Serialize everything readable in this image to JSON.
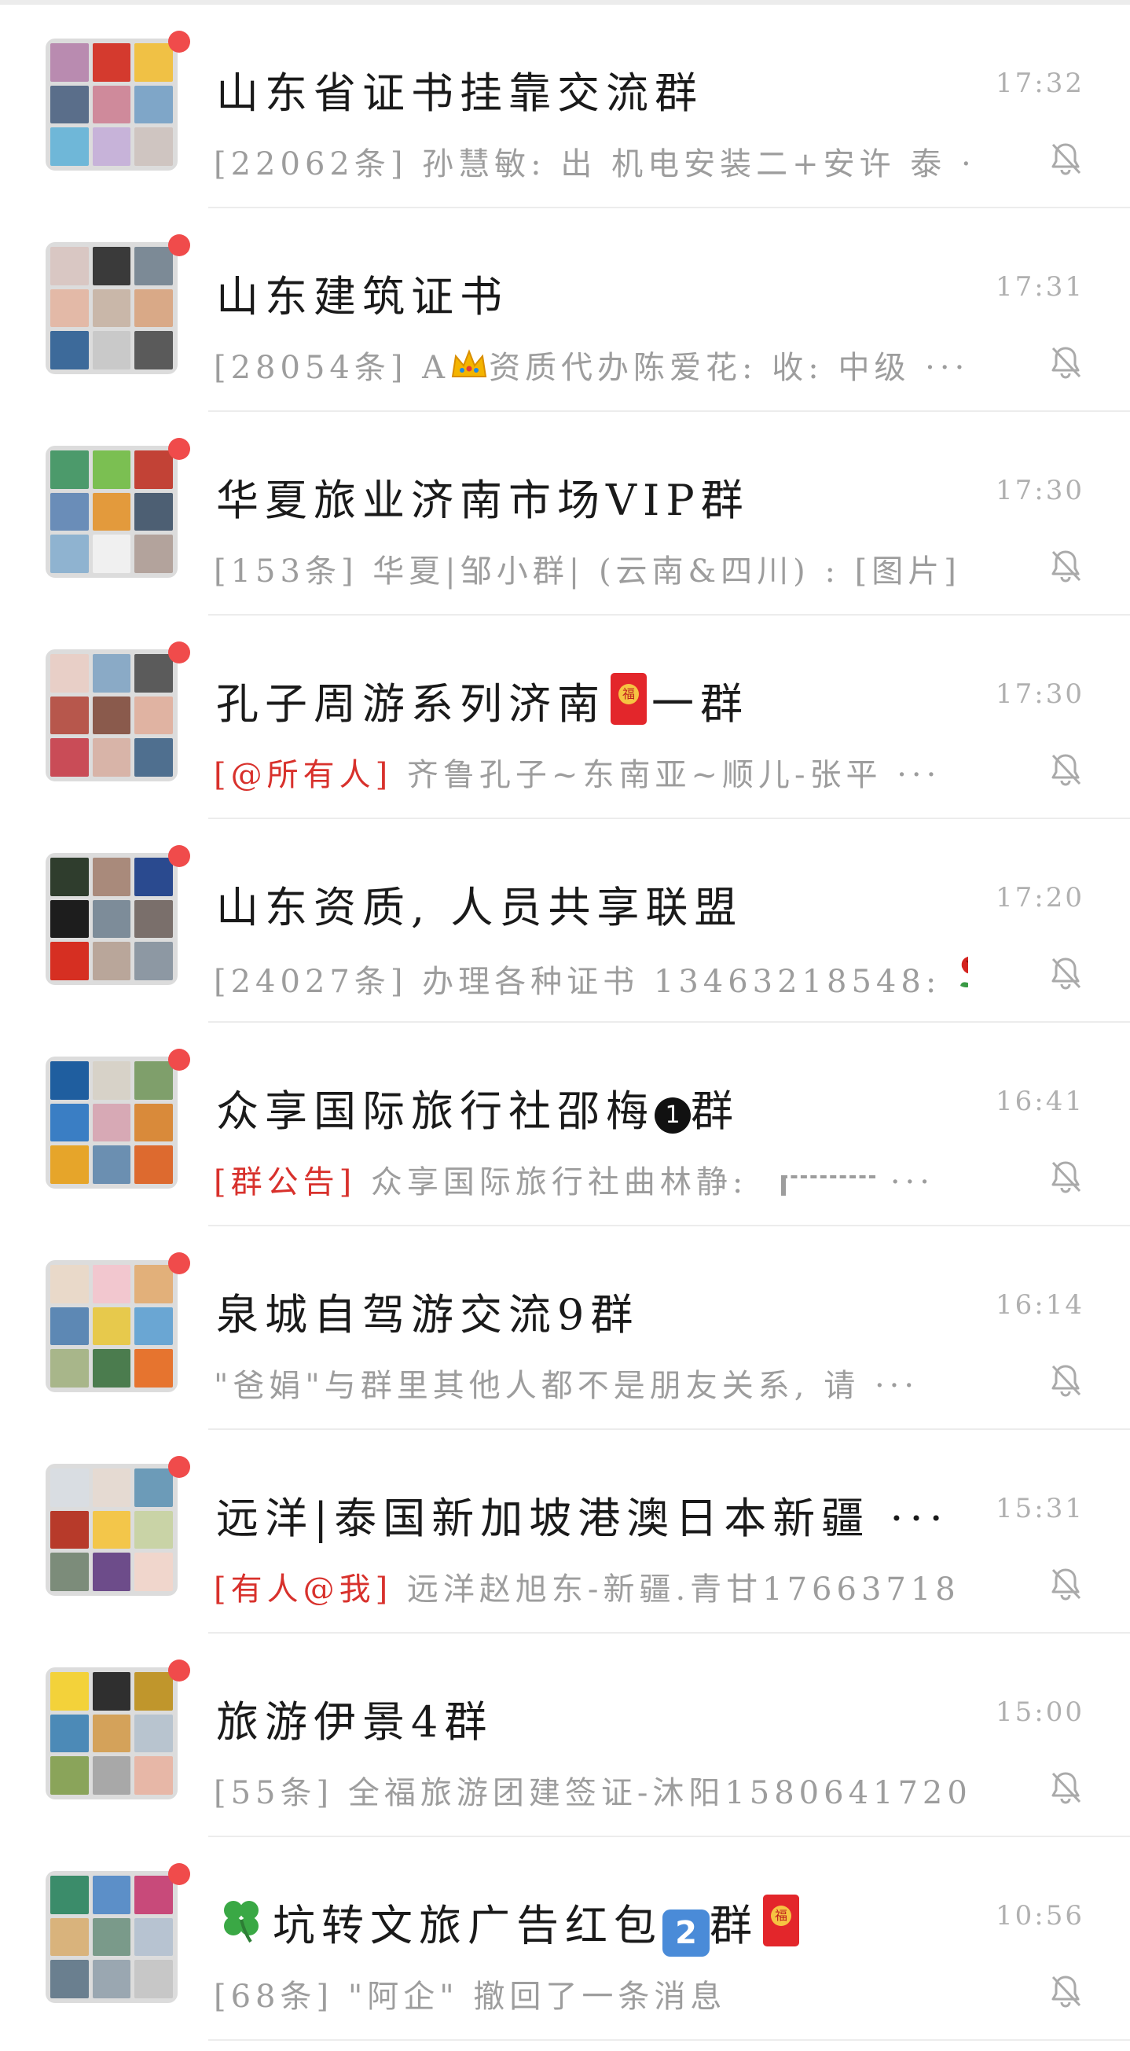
{
  "chats": [
    {
      "title": "山东省证书挂靠交流群",
      "title_extra": "",
      "preview_tag": "",
      "preview": "[22062条] 孙慧敏: 出 机电安装二+安许 泰 ···",
      "time": "17:32",
      "avatar_colors": [
        "#b98bb0",
        "#d43a2e",
        "#f0c145",
        "#5a6e8a",
        "#cf8a9b",
        "#7fa6c8",
        "#6fb7d8",
        "#c7b3d9",
        "#cfc5c1"
      ]
    },
    {
      "title": "山东建筑证书",
      "title_extra": "",
      "preview_tag": "",
      "preview_before": "[28054条] A",
      "preview_after": "资质代办陈爱花: 收: 中级 ···",
      "time": "17:31",
      "avatar_colors": [
        "#d9c7c3",
        "#3a3a3a",
        "#7c8a96",
        "#e3b9a7",
        "#c9b7a9",
        "#d9a987",
        "#3d6a9a",
        "#c9c9c9",
        "#5a5a5a"
      ]
    },
    {
      "title": "华夏旅业济南市场VIP群",
      "title_extra": "",
      "preview_tag": "",
      "preview": "[153条] 华夏|邹小群| (云南&四川) : [图片]",
      "time": "17:30",
      "avatar_colors": [
        "#4c9a6b",
        "#7bbf52",
        "#c24236",
        "#6a8db8",
        "#e39a3c",
        "#4d5f73",
        "#8fb3d0",
        "#f0f0f0",
        "#b3a39c"
      ]
    },
    {
      "title": "孔子周游系列济南",
      "title_extra": "一群",
      "preview_tag": "[@所有人]",
      "preview": " 齐鲁孔子~东南亚~顺儿-张平 ···",
      "time": "17:30",
      "avatar_colors": [
        "#e8cfc7",
        "#8aaac6",
        "#5b5b5b",
        "#b7574c",
        "#8a5a4c",
        "#e0b3a2",
        "#c94c57",
        "#d8b4a8",
        "#4f6f8f"
      ]
    },
    {
      "title": "山东资质, 人员共享联盟",
      "title_extra": "",
      "preview_tag": "",
      "preview_before": "[24027条] 办理各种证书 13463218548: ",
      "preview_after": " ···",
      "time": "17:20",
      "avatar_colors": [
        "#2f3d2d",
        "#a98a7b",
        "#2a4a8f",
        "#1d1d1d",
        "#7d8c99",
        "#7a6f6b",
        "#d62f22",
        "#b9a69a",
        "#8d98a3"
      ]
    },
    {
      "title": "众享国际旅行社邵梅",
      "title_extra": "群",
      "preview_tag": "[群公告]",
      "preview": " 众享国际旅行社曲林静: ",
      "preview_after": " ···",
      "time": "16:41",
      "avatar_colors": [
        "#1f5e9f",
        "#d7d2c8",
        "#7f9f6b",
        "#3a7ec4",
        "#d7a9b5",
        "#d98a3a",
        "#e6a52a",
        "#6b8fb1",
        "#dd6a2f"
      ]
    },
    {
      "title": "泉城自驾游交流9群",
      "title_extra": "",
      "preview_tag": "",
      "preview": "\"爸娟\"与群里其他人都不是朋友关系, 请 ···",
      "time": "16:14",
      "avatar_colors": [
        "#e9d9c9",
        "#f2c7cf",
        "#e2b07a",
        "#5d88b4",
        "#e7c94c",
        "#6aa6d3",
        "#a8b68a",
        "#4b7c4e",
        "#e6742f"
      ]
    },
    {
      "title": "远洋|泰国新加坡港澳日本新疆 ···",
      "title_extra": "",
      "preview_tag": "[有人@我]",
      "preview": " 远洋赵旭东-新疆.青甘17663718 ···",
      "time": "15:31",
      "avatar_colors": [
        "#d9dde2",
        "#e5dad2",
        "#6c9bb8",
        "#b73a2a",
        "#f3c64a",
        "#c9d3a6",
        "#7c8c7a",
        "#6d4c8a",
        "#f0d6cc"
      ]
    },
    {
      "title": "旅游伊景4群",
      "title_extra": "",
      "preview_tag": "",
      "preview": "[55条] 全福旅游团建签证-沐阳1580641720 ···",
      "time": "15:00",
      "avatar_colors": [
        "#f3d23a",
        "#2f2f2f",
        "#c0962c",
        "#4c8ab7",
        "#d4a25a",
        "#b8c4cf",
        "#8aa45a",
        "#a8a8a8",
        "#e7b7a7"
      ]
    },
    {
      "title": "坑转文旅广告红包",
      "title_extra": "群",
      "preview_tag": "",
      "preview": "[68条] \"阿企\" 撤回了一条消息",
      "time": "10:56",
      "avatar_colors": [
        "#3b8c6a",
        "#5c8fc8",
        "#c84a7a",
        "#d9b37c",
        "#7a9a8a",
        "#b7c3d1",
        "#6a7f8f",
        "#9aa7b1",
        "#c7c7c7"
      ]
    }
  ],
  "icons": {
    "mute": "bell-slash-icon",
    "crown": "crown-emoji",
    "rose": "rose-emoji",
    "clover": "four-leaf-clover-emoji",
    "hongbao": "red-envelope-emoji"
  }
}
